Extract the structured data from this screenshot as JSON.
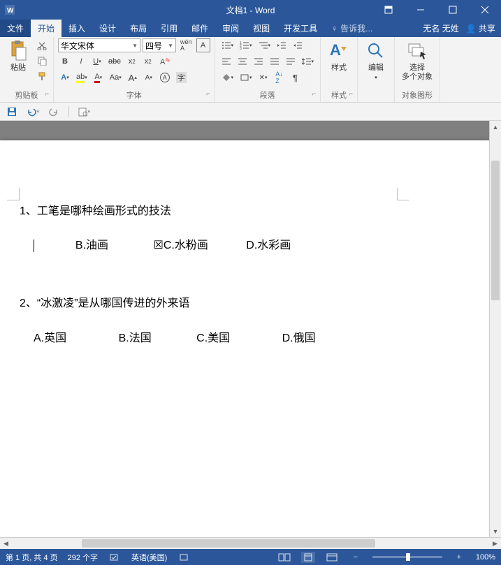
{
  "title": "文档1 - Word",
  "menu": {
    "file": "文件",
    "home": "开始",
    "insert": "插入",
    "design": "设计",
    "layout": "布局",
    "references": "引用",
    "mailings": "邮件",
    "review": "审阅",
    "view": "视图",
    "developer": "开发工具",
    "tell": "告诉我...",
    "user": "无名 无姓",
    "share": "共享"
  },
  "ribbon": {
    "clipboard": {
      "paste": "粘贴",
      "label": "剪贴板"
    },
    "font": {
      "name": "华文宋体",
      "size": "四号",
      "label": "字体"
    },
    "paragraph": {
      "label": "段落"
    },
    "styles": {
      "btn": "样式",
      "label": "样式"
    },
    "editing": {
      "btn": "编辑"
    },
    "objects": {
      "btn": "选择\n多个对象",
      "label": "对象图形"
    }
  },
  "doc": {
    "q1": "1、工笔是哪种绘画形式的技法",
    "opts1": {
      "b": "B.油画",
      "c": "C.水粉画",
      "d": "D.水彩画",
      "mark": "☒"
    },
    "q2": "2、“冰激凌”是从哪国传进的外来语",
    "opts2": {
      "a": "A.英国",
      "b": "B.法国",
      "c": "C.美国",
      "d": "D.俄国"
    }
  },
  "status": {
    "page": "第 1 页, 共 4 页",
    "words": "292 个字",
    "lang": "英语(美国)",
    "zoom": "100%"
  }
}
